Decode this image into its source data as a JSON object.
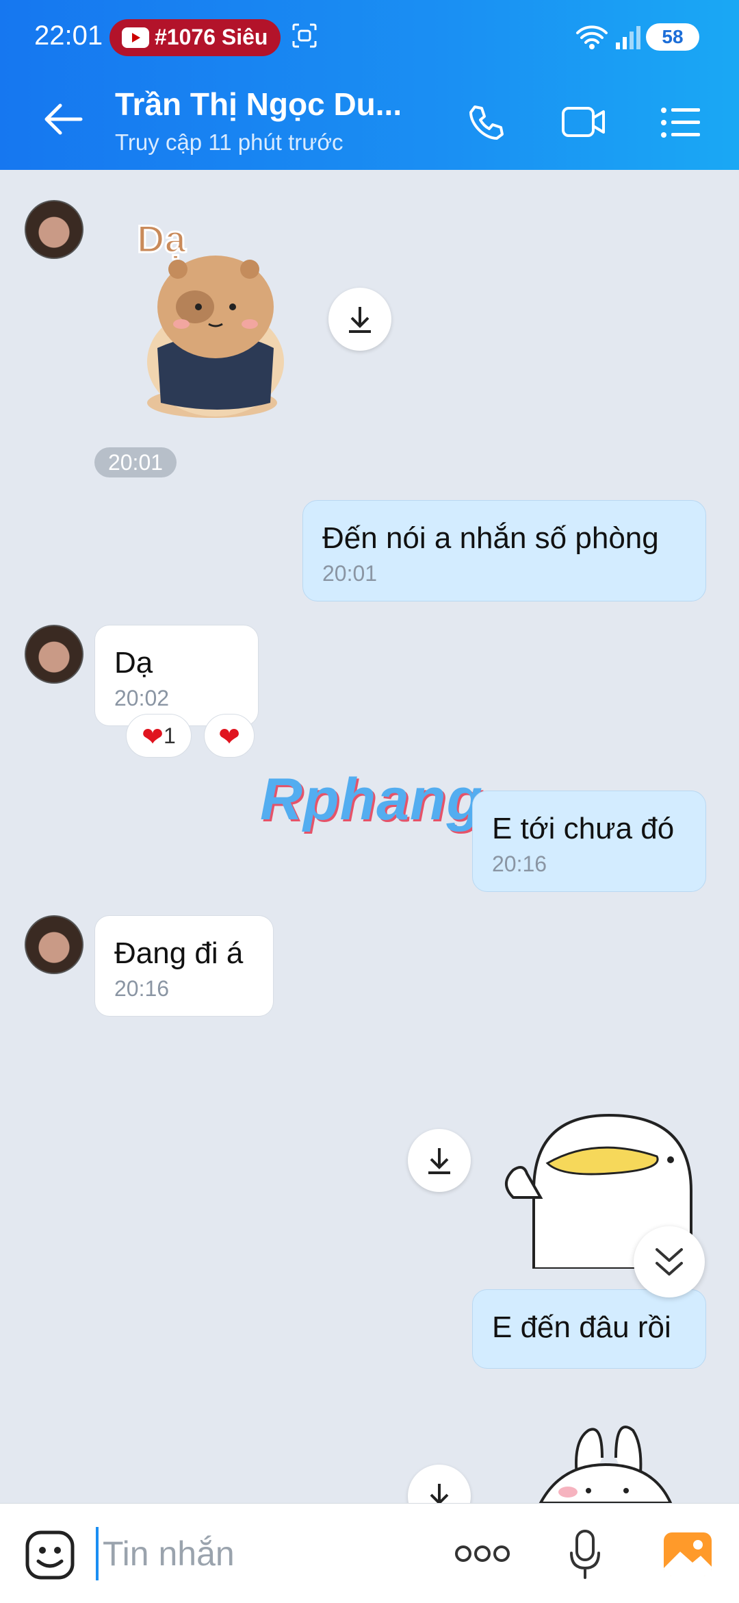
{
  "status_bar": {
    "time": "22:01",
    "notification": "#1076 Siêu",
    "battery": "58"
  },
  "header": {
    "contact_name": "Trần Thị Ngọc Du...",
    "last_seen": "Truy cập 11 phút trước"
  },
  "messages": {
    "sticker1_time": "20:01",
    "out1_text": "Đến nói a nhắn số phòng",
    "out1_time": "20:01",
    "in1_text": "Dạ",
    "in1_time": "20:02",
    "in1_reaction_count": "1",
    "out2_text": "E tới chưa đó",
    "out2_time": "20:16",
    "in2_text": "Đang đi á",
    "in2_time": "20:16",
    "out3_text": "E đến đâu rồi"
  },
  "watermark": "Rphang",
  "composer": {
    "placeholder": "Tin nhắn"
  },
  "colors": {
    "header_gradient_start": "#1677f0",
    "header_gradient_end": "#1aa8f4",
    "outgoing_bubble": "#d3ecff",
    "incoming_bubble": "#ffffff",
    "chat_background": "#e3e8f0"
  }
}
